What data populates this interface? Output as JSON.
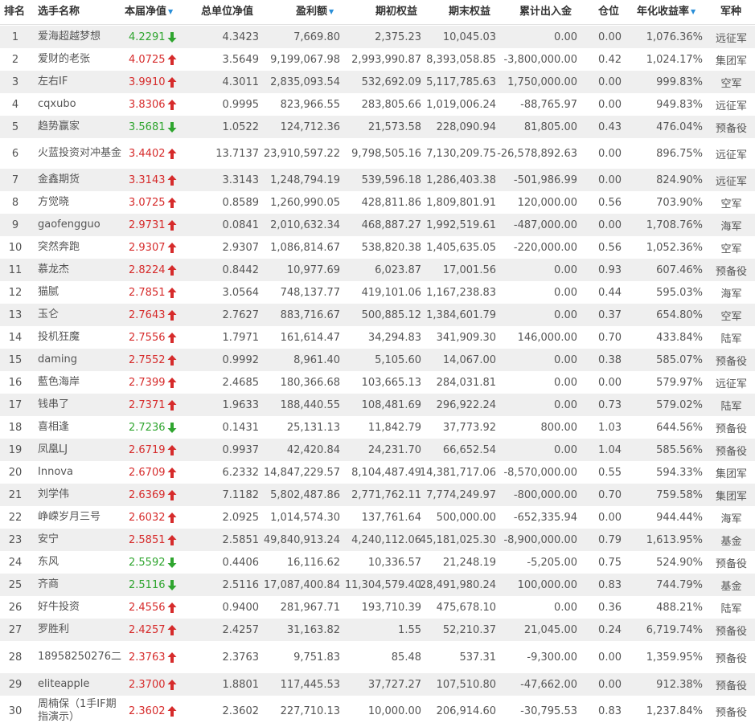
{
  "columns": [
    {
      "label": "排名"
    },
    {
      "label": "选手名称"
    },
    {
      "label": "本届净值",
      "sort": true
    },
    {
      "label": "总单位净值"
    },
    {
      "label": "盈利额",
      "sort": true
    },
    {
      "label": "期初权益"
    },
    {
      "label": "期末权益"
    },
    {
      "label": "累计出入金"
    },
    {
      "label": "仓位"
    },
    {
      "label": "年化收益率",
      "sort": true
    },
    {
      "label": "军种"
    }
  ],
  "colors": {
    "up": "#d62b2b",
    "down": "#2fa52f",
    "sort": "#2a8fd8"
  },
  "rows": [
    {
      "rank": "1",
      "name": "爱海超越梦想",
      "nav": "4.2291",
      "dir": "down",
      "tnav": "4.3423",
      "profit": "7,669.80",
      "start": "2,375.23",
      "end": "10,045.03",
      "flow": "0.00",
      "pos": "0.00",
      "ann": "1,076.36%",
      "cat": "远征军"
    },
    {
      "rank": "2",
      "name": "爱财的老张",
      "nav": "4.0725",
      "dir": "up",
      "tnav": "3.5649",
      "profit": "9,199,067.98",
      "start": "2,993,990.87",
      "end": "8,393,058.85",
      "flow": "-3,800,000.00",
      "pos": "0.42",
      "ann": "1,024.17%",
      "cat": "集团军"
    },
    {
      "rank": "3",
      "name": "左右IF",
      "nav": "3.9910",
      "dir": "up",
      "tnav": "4.3011",
      "profit": "2,835,093.54",
      "start": "532,692.09",
      "end": "5,117,785.63",
      "flow": "1,750,000.00",
      "pos": "0.00",
      "ann": "999.83%",
      "cat": "空军"
    },
    {
      "rank": "4",
      "name": "cqxubo",
      "nav": "3.8306",
      "dir": "up",
      "tnav": "0.9995",
      "profit": "823,966.55",
      "start": "283,805.66",
      "end": "1,019,006.24",
      "flow": "-88,765.97",
      "pos": "0.00",
      "ann": "949.83%",
      "cat": "远征军"
    },
    {
      "rank": "5",
      "name": "趋势赢家",
      "nav": "3.5681",
      "dir": "down",
      "tnav": "1.0522",
      "profit": "124,712.36",
      "start": "21,573.58",
      "end": "228,090.94",
      "flow": "81,805.00",
      "pos": "0.43",
      "ann": "476.04%",
      "cat": "预备役"
    },
    {
      "rank": "6",
      "name": "火蓝投资对冲基金",
      "nav": "3.4402",
      "dir": "up",
      "tnav": "13.7137",
      "profit": "23,910,597.22",
      "start": "9,798,505.16",
      "end": "7,130,209.75",
      "flow": "-26,578,892.63",
      "pos": "0.00",
      "ann": "896.75%",
      "cat": "远征军"
    },
    {
      "rank": "7",
      "name": "金鑫期货",
      "nav": "3.3143",
      "dir": "up",
      "tnav": "3.3143",
      "profit": "1,248,794.19",
      "start": "539,596.18",
      "end": "1,286,403.38",
      "flow": "-501,986.99",
      "pos": "0.00",
      "ann": "824.90%",
      "cat": "远征军"
    },
    {
      "rank": "8",
      "name": "方觉晓",
      "nav": "3.0725",
      "dir": "up",
      "tnav": "0.8589",
      "profit": "1,260,990.05",
      "start": "428,811.86",
      "end": "1,809,801.91",
      "flow": "120,000.00",
      "pos": "0.56",
      "ann": "703.90%",
      "cat": "空军"
    },
    {
      "rank": "9",
      "name": "gaofengguo",
      "nav": "2.9731",
      "dir": "up",
      "tnav": "0.0841",
      "profit": "2,010,632.34",
      "start": "468,887.27",
      "end": "1,992,519.61",
      "flow": "-487,000.00",
      "pos": "0.00",
      "ann": "1,708.76%",
      "cat": "海军"
    },
    {
      "rank": "10",
      "name": "突然奔跑",
      "nav": "2.9307",
      "dir": "up",
      "tnav": "2.9307",
      "profit": "1,086,814.67",
      "start": "538,820.38",
      "end": "1,405,635.05",
      "flow": "-220,000.00",
      "pos": "0.56",
      "ann": "1,052.36%",
      "cat": "空军"
    },
    {
      "rank": "11",
      "name": "慕龙杰",
      "nav": "2.8224",
      "dir": "up",
      "tnav": "0.8442",
      "profit": "10,977.69",
      "start": "6,023.87",
      "end": "17,001.56",
      "flow": "0.00",
      "pos": "0.93",
      "ann": "607.46%",
      "cat": "预备役"
    },
    {
      "rank": "12",
      "name": "猫腻",
      "nav": "2.7851",
      "dir": "up",
      "tnav": "3.0564",
      "profit": "748,137.77",
      "start": "419,101.06",
      "end": "1,167,238.83",
      "flow": "0.00",
      "pos": "0.44",
      "ann": "595.03%",
      "cat": "海军"
    },
    {
      "rank": "13",
      "name": "玉仑",
      "nav": "2.7643",
      "dir": "up",
      "tnav": "2.7627",
      "profit": "883,716.67",
      "start": "500,885.12",
      "end": "1,384,601.79",
      "flow": "0.00",
      "pos": "0.37",
      "ann": "654.80%",
      "cat": "空军"
    },
    {
      "rank": "14",
      "name": "投机狂魔",
      "nav": "2.7556",
      "dir": "up",
      "tnav": "1.7971",
      "profit": "161,614.47",
      "start": "34,294.83",
      "end": "341,909.30",
      "flow": "146,000.00",
      "pos": "0.70",
      "ann": "433.84%",
      "cat": "陆军"
    },
    {
      "rank": "15",
      "name": "daming",
      "nav": "2.7552",
      "dir": "up",
      "tnav": "0.9992",
      "profit": "8,961.40",
      "start": "5,105.60",
      "end": "14,067.00",
      "flow": "0.00",
      "pos": "0.38",
      "ann": "585.07%",
      "cat": "预备役"
    },
    {
      "rank": "16",
      "name": "藍色海岸",
      "nav": "2.7399",
      "dir": "up",
      "tnav": "2.4685",
      "profit": "180,366.68",
      "start": "103,665.13",
      "end": "284,031.81",
      "flow": "0.00",
      "pos": "0.00",
      "ann": "579.97%",
      "cat": "远征军"
    },
    {
      "rank": "17",
      "name": "钱串了",
      "nav": "2.7371",
      "dir": "up",
      "tnav": "1.9633",
      "profit": "188,440.55",
      "start": "108,481.69",
      "end": "296,922.24",
      "flow": "0.00",
      "pos": "0.73",
      "ann": "579.02%",
      "cat": "陆军"
    },
    {
      "rank": "18",
      "name": "喜相逢",
      "nav": "2.7236",
      "dir": "down",
      "tnav": "0.1431",
      "profit": "25,131.13",
      "start": "11,842.79",
      "end": "37,773.92",
      "flow": "800.00",
      "pos": "1.03",
      "ann": "644.56%",
      "cat": "预备役"
    },
    {
      "rank": "19",
      "name": "凤凰LJ",
      "nav": "2.6719",
      "dir": "up",
      "tnav": "0.9937",
      "profit": "42,420.84",
      "start": "24,231.70",
      "end": "66,652.54",
      "flow": "0.00",
      "pos": "1.04",
      "ann": "585.56%",
      "cat": "预备役"
    },
    {
      "rank": "20",
      "name": "Innova",
      "nav": "2.6709",
      "dir": "up",
      "tnav": "6.2332",
      "profit": "14,847,229.57",
      "start": "8,104,487.49",
      "end": "14,381,717.06",
      "flow": "-8,570,000.00",
      "pos": "0.55",
      "ann": "594.33%",
      "cat": "集团军"
    },
    {
      "rank": "21",
      "name": "刘学伟",
      "nav": "2.6369",
      "dir": "up",
      "tnav": "7.1182",
      "profit": "5,802,487.86",
      "start": "2,771,762.11",
      "end": "7,774,249.97",
      "flow": "-800,000.00",
      "pos": "0.70",
      "ann": "759.58%",
      "cat": "集团军"
    },
    {
      "rank": "22",
      "name": "峥嵘岁月三号",
      "nav": "2.6032",
      "dir": "up",
      "tnav": "2.0925",
      "profit": "1,014,574.30",
      "start": "137,761.64",
      "end": "500,000.00",
      "flow": "-652,335.94",
      "pos": "0.00",
      "ann": "944.44%",
      "cat": "海军"
    },
    {
      "rank": "23",
      "name": "安宁",
      "nav": "2.5851",
      "dir": "up",
      "tnav": "2.5851",
      "profit": "49,840,913.24",
      "start": "4,240,112.06",
      "end": "45,181,025.30",
      "flow": "-8,900,000.00",
      "pos": "0.79",
      "ann": "1,613.95%",
      "cat": "基金"
    },
    {
      "rank": "24",
      "name": "东风",
      "nav": "2.5592",
      "dir": "down",
      "tnav": "0.4406",
      "profit": "16,116.62",
      "start": "10,336.57",
      "end": "21,248.19",
      "flow": "-5,205.00",
      "pos": "0.75",
      "ann": "524.90%",
      "cat": "预备役"
    },
    {
      "rank": "25",
      "name": "齐商",
      "nav": "2.5116",
      "dir": "down",
      "tnav": "2.5116",
      "profit": "17,087,400.84",
      "start": "11,304,579.40",
      "end": "28,491,980.24",
      "flow": "100,000.00",
      "pos": "0.83",
      "ann": "744.79%",
      "cat": "基金"
    },
    {
      "rank": "26",
      "name": "好牛投资",
      "nav": "2.4556",
      "dir": "up",
      "tnav": "0.9400",
      "profit": "281,967.71",
      "start": "193,710.39",
      "end": "475,678.10",
      "flow": "0.00",
      "pos": "0.36",
      "ann": "488.21%",
      "cat": "陆军"
    },
    {
      "rank": "27",
      "name": "罗胜利",
      "nav": "2.4257",
      "dir": "up",
      "tnav": "2.4257",
      "profit": "31,163.82",
      "start": "1.55",
      "end": "52,210.37",
      "flow": "21,045.00",
      "pos": "0.24",
      "ann": "6,719.74%",
      "cat": "预备役"
    },
    {
      "rank": "28",
      "name": "18958250276二",
      "nav": "2.3763",
      "dir": "up",
      "tnav": "2.3763",
      "profit": "9,751.83",
      "start": "85.48",
      "end": "537.31",
      "flow": "-9,300.00",
      "pos": "0.00",
      "ann": "1,359.95%",
      "cat": "预备役"
    },
    {
      "rank": "29",
      "name": "eliteapple",
      "nav": "2.3700",
      "dir": "up",
      "tnav": "1.8801",
      "profit": "117,445.53",
      "start": "37,727.27",
      "end": "107,510.80",
      "flow": "-47,662.00",
      "pos": "0.00",
      "ann": "912.38%",
      "cat": "预备役"
    },
    {
      "rank": "30",
      "name": "周楠保（1手IF期指演示）",
      "nav": "2.3602",
      "dir": "up",
      "tnav": "2.3602",
      "profit": "227,710.13",
      "start": "10,000.00",
      "end": "206,914.60",
      "flow": "-30,795.53",
      "pos": "0.83",
      "ann": "1,237.84%",
      "cat": "预备役"
    }
  ]
}
